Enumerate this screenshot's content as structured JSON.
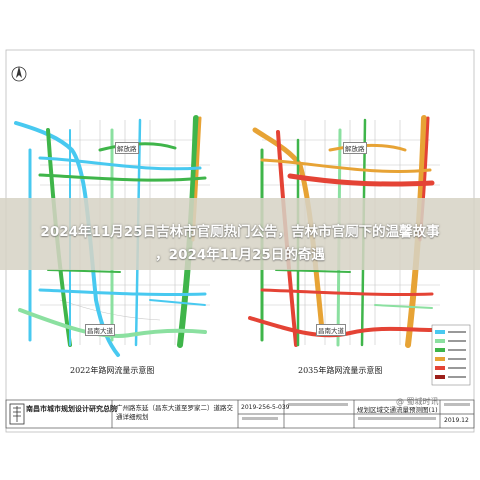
{
  "overlay": {
    "line1": "2024年11月25日吉林市官厕热门公告，吉林市官厕下的温馨故事",
    "line2": "，2024年11月25日的奇遇"
  },
  "maps": {
    "left_caption": "2022年路网流量示意图",
    "right_caption": "2035年路网流量示意图",
    "left_road_tags": [
      "解放路",
      "昌南大道"
    ],
    "right_road_tags": [
      "解放路",
      "昌南大道"
    ],
    "north_arrow": "N"
  },
  "title_block": {
    "org": "南昌市城市规划设计研究总院",
    "project": "广州路东延（昌东大道至罗家二）道路交通详细规划",
    "drawing_no": "2019-256-5-039",
    "drawing_name": "规划区域交通流量预测图(1)",
    "date_label": "2019.12"
  },
  "watermark": "@ 蜀城时讯",
  "colors": {
    "low": "#48c9f0",
    "med_low": "#8be0a0",
    "medium": "#3fb54a",
    "high": "#e7a335",
    "very_high": "#e44335"
  }
}
